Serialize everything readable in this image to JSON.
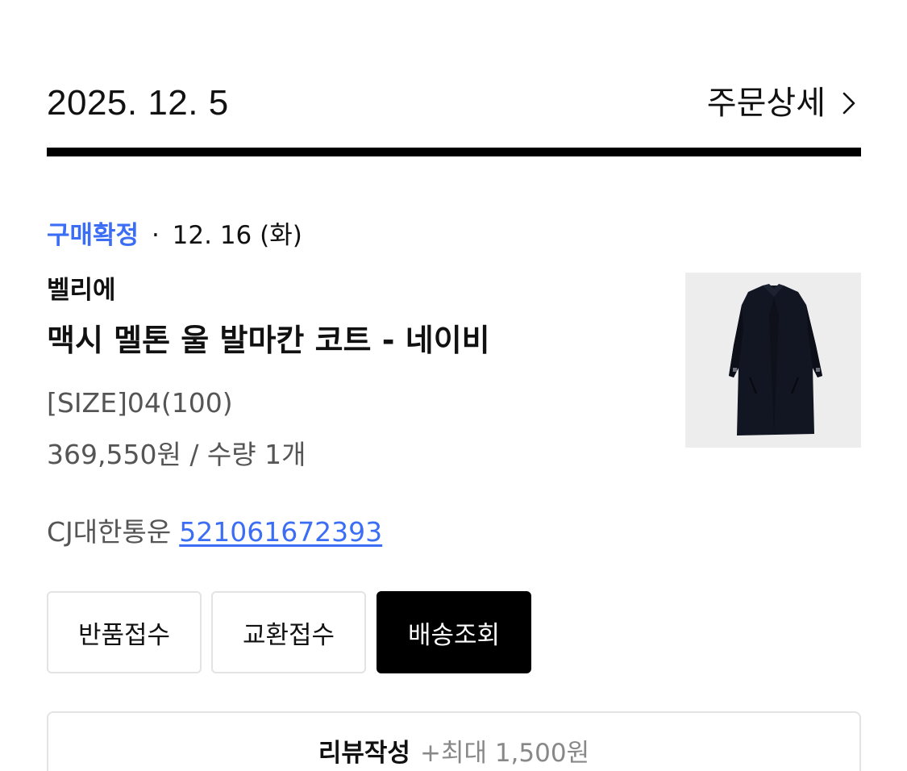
{
  "order": {
    "date": "2025. 12. 5",
    "detail_label": "주문상세"
  },
  "item": {
    "status_label": "구매확정",
    "status_separator": "·",
    "status_date": "12. 16 (화)",
    "brand": "벨리에",
    "name": "맥시 멜톤 울 발마칸 코트 - 네이비",
    "option": "[SIZE]04(100)",
    "price_qty": "369,550원 / 수량 1개",
    "carrier": "CJ대한통운",
    "tracking_number": "521061672393"
  },
  "actions": {
    "return_label": "반품접수",
    "exchange_label": "교환접수",
    "track_label": "배송조회"
  },
  "review": {
    "label": "리뷰작성",
    "bonus": "+최대 1,500원"
  },
  "colors": {
    "accent": "#3b6ef5",
    "primary_button": "#000000",
    "divider": "#000000",
    "border": "#e3e3e3",
    "thumbnail_bg": "#ededed"
  },
  "icons": {
    "detail_chevron": "chevron-right-icon",
    "product_image": "navy-coat-product-image"
  }
}
